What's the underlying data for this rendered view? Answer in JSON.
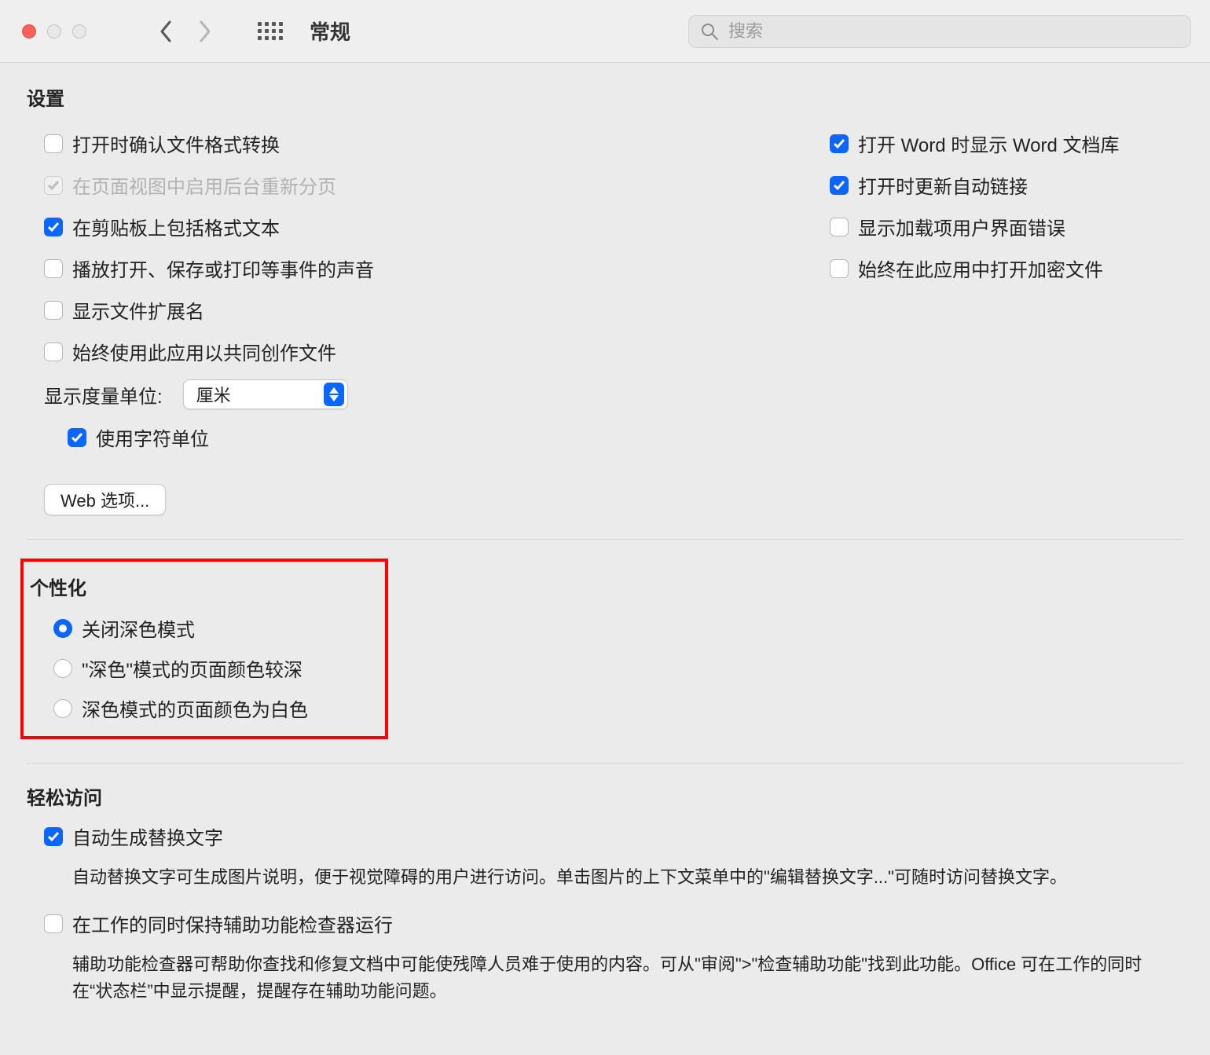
{
  "toolbar": {
    "title": "常规",
    "search_placeholder": "搜索"
  },
  "settings": {
    "title": "设置",
    "left": [
      {
        "label": "打开时确认文件格式转换",
        "checked": false,
        "disabled": false
      },
      {
        "label": "在页面视图中启用后台重新分页",
        "checked": true,
        "disabled": true
      },
      {
        "label": "在剪贴板上包括格式文本",
        "checked": true,
        "disabled": false
      },
      {
        "label": "播放打开、保存或打印等事件的声音",
        "checked": false,
        "disabled": false
      },
      {
        "label": "显示文件扩展名",
        "checked": false,
        "disabled": false
      },
      {
        "label": "始终使用此应用以共同创作文件",
        "checked": false,
        "disabled": false
      }
    ],
    "right": [
      {
        "label": "打开 Word 时显示 Word 文档库",
        "checked": true
      },
      {
        "label": "打开时更新自动链接",
        "checked": true
      },
      {
        "label": "显示加载项用户界面错误",
        "checked": false
      },
      {
        "label": "始终在此应用中打开加密文件",
        "checked": false
      }
    ],
    "measure_label": "显示度量单位:",
    "measure_value": "厘米",
    "use_char_unit": {
      "label": "使用字符单位",
      "checked": true
    },
    "web_button": "Web 选项..."
  },
  "personal": {
    "title": "个性化",
    "radios": [
      {
        "label": "关闭深色模式",
        "checked": true
      },
      {
        "label": "\"深色\"模式的页面颜色较深",
        "checked": false
      },
      {
        "label": "深色模式的页面颜色为白色",
        "checked": false
      }
    ]
  },
  "access": {
    "title": "轻松访问",
    "auto_alt": {
      "label": "自动生成替换文字",
      "checked": true
    },
    "auto_alt_help": "自动替换文字可生成图片说明，便于视觉障碍的用户进行访问。单击图片的上下文菜单中的\"编辑替换文字...\"可随时访问替换文字。",
    "keep_checker": {
      "label": "在工作的同时保持辅助功能检查器运行",
      "checked": false
    },
    "keep_checker_help": "辅助功能检查器可帮助你查找和修复文档中可能使残障人员难于使用的内容。可从\"审阅\">\"检查辅助功能\"找到此功能。Office 可在工作的同时在“状态栏”中显示提醒，提醒存在辅助功能问题。"
  }
}
